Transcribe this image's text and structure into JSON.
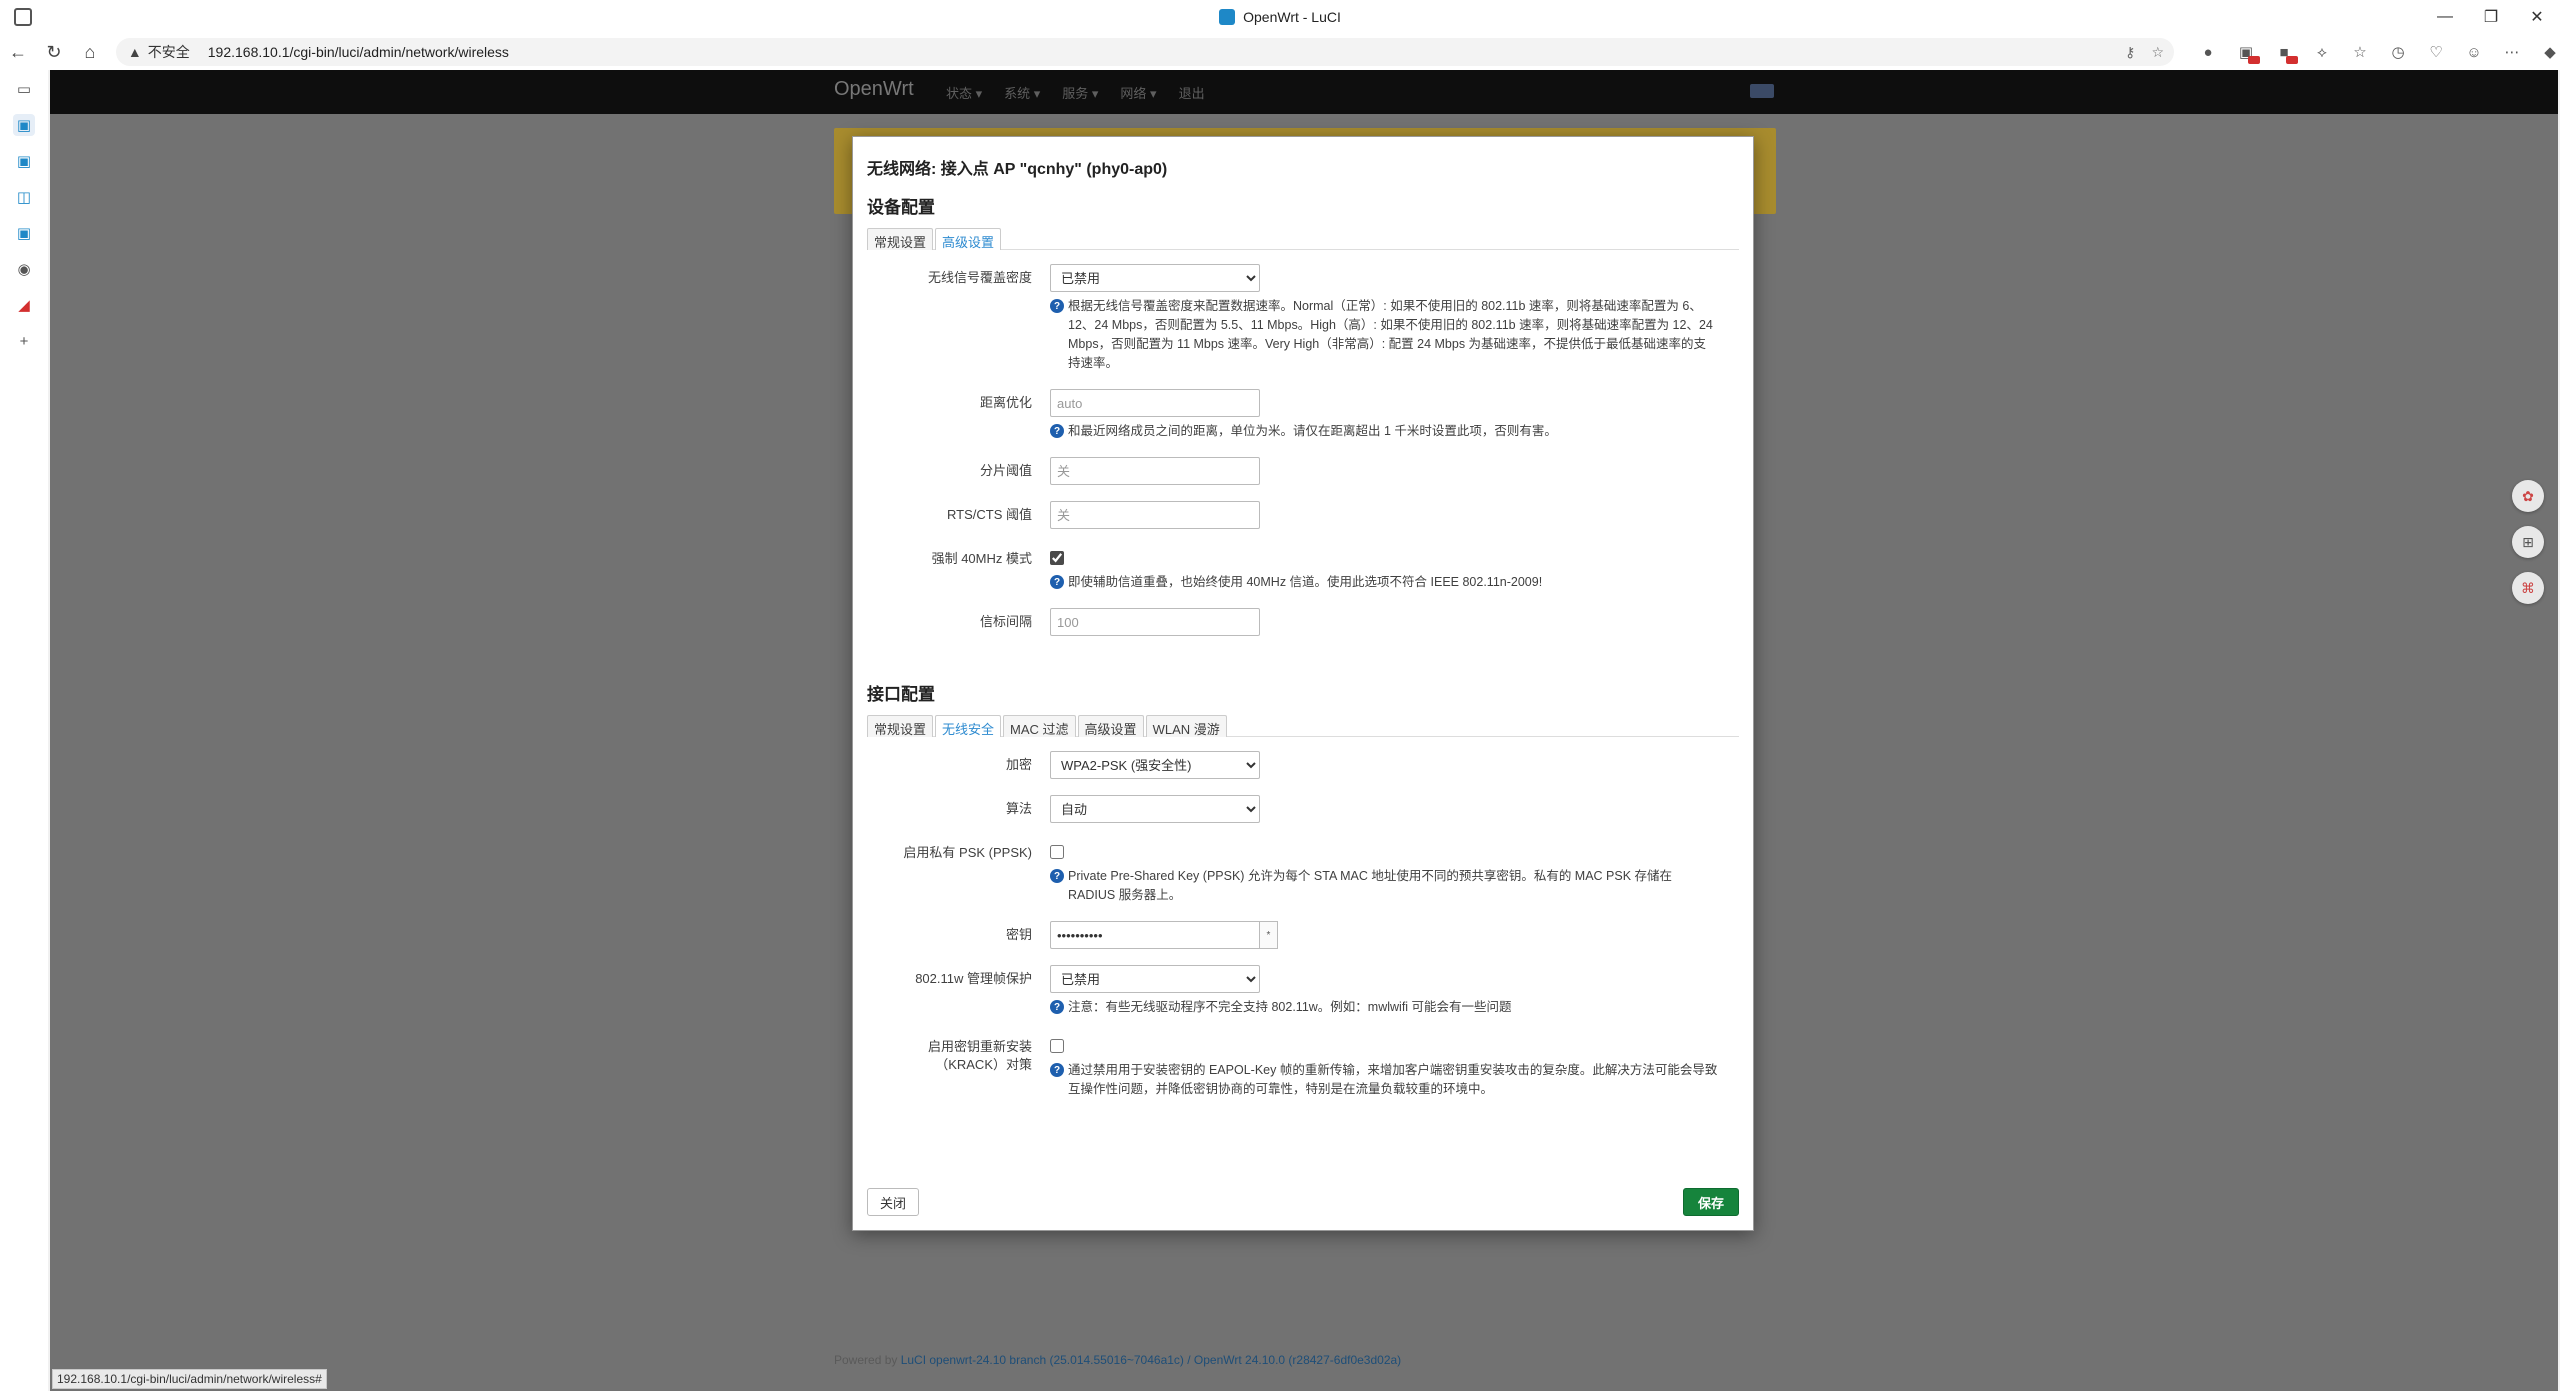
{
  "browser": {
    "window_title": "OpenWrt - LuCI",
    "insecure_label": "不安全",
    "url": "192.168.10.1/cgi-bin/luci/admin/network/wireless",
    "status_url": "192.168.10.1/cgi-bin/luci/admin/network/wireless#"
  },
  "background_page": {
    "brand": "OpenWrt",
    "menu": [
      "状态 ▾",
      "系统 ▾",
      "服务 ▾",
      "网络 ▾",
      "退出"
    ],
    "footer_prefix": "Powered by ",
    "footer_link": "LuCI openwrt-24.10 branch (25.014.55016~7046a1c) / OpenWrt 24.10.0 (r28427-6df0e3d02a)"
  },
  "modal": {
    "title": "无线网络: 接入点 AP \"qcnhy\" (phy0-ap0)",
    "device_section": {
      "heading": "设备配置",
      "tabs": [
        "常规设置",
        "高级设置"
      ],
      "active_tab": 1,
      "fields": {
        "coverage": {
          "label": "无线信号覆盖密度",
          "value": "已禁用",
          "help": "根据无线信号覆盖密度来配置数据速率。Normal（正常）: 如果不使用旧的 802.11b 速率，则将基础速率配置为 6、12、24 Mbps，否则配置为 5.5、11 Mbps。High（高）: 如果不使用旧的 802.11b 速率，则将基础速率配置为 12、24 Mbps，否则配置为 11 Mbps 速率。Very High（非常高）: 配置 24 Mbps 为基础速率，不提供低于最低基础速率的支持速率。"
        },
        "distance": {
          "label": "距离优化",
          "placeholder": "auto",
          "help": "和最近网络成员之间的距离，单位为米。请仅在距离超出 1 千米时设置此项，否则有害。"
        },
        "frag": {
          "label": "分片阈值",
          "placeholder": "关"
        },
        "rts": {
          "label": "RTS/CTS 阈值",
          "placeholder": "关"
        },
        "force40": {
          "label": "强制 40MHz 模式",
          "checked": true,
          "help": "即使辅助信道重叠，也始终使用 40MHz 信道。使用此选项不符合 IEEE 802.11n-2009!"
        },
        "beacon": {
          "label": "信标间隔",
          "placeholder": "100"
        }
      }
    },
    "interface_section": {
      "heading": "接口配置",
      "tabs": [
        "常规设置",
        "无线安全",
        "MAC 过滤",
        "高级设置",
        "WLAN 漫游"
      ],
      "active_tab": 1,
      "fields": {
        "encryption": {
          "label": "加密",
          "value": "WPA2-PSK (强安全性)"
        },
        "cipher": {
          "label": "算法",
          "value": "自动"
        },
        "ppsk": {
          "label": "启用私有 PSK (PPSK)",
          "checked": false,
          "help": "Private Pre-Shared Key (PPSK) 允许为每个 STA MAC 地址使用不同的预共享密钥。私有的 MAC PSK 存储在 RADIUS 服务器上。"
        },
        "key": {
          "label": "密钥",
          "value": "••••••••••",
          "reveal_icon": "*"
        },
        "ieee80211w": {
          "label": "802.11w 管理帧保护",
          "value": "已禁用",
          "help": "注意：有些无线驱动程序不完全支持 802.11w。例如：mwlwifi 可能会有一些问题"
        },
        "krack": {
          "label": "启用密钥重新安装（KRACK）对策",
          "checked": false,
          "help": "通过禁用用于安装密钥的 EAPOL-Key 帧的重新传输，来增加客户端密钥重安装攻击的复杂度。此解决方法可能会导致互操作性问题，并降低密钥协商的可靠性，特别是在流量负载较重的环境中。"
        }
      }
    },
    "buttons": {
      "close": "关闭",
      "save": "保存"
    }
  },
  "colors": {
    "save": "#16843c",
    "tab_active": "#2e8bd0",
    "help_icon": "#1e5fae"
  }
}
